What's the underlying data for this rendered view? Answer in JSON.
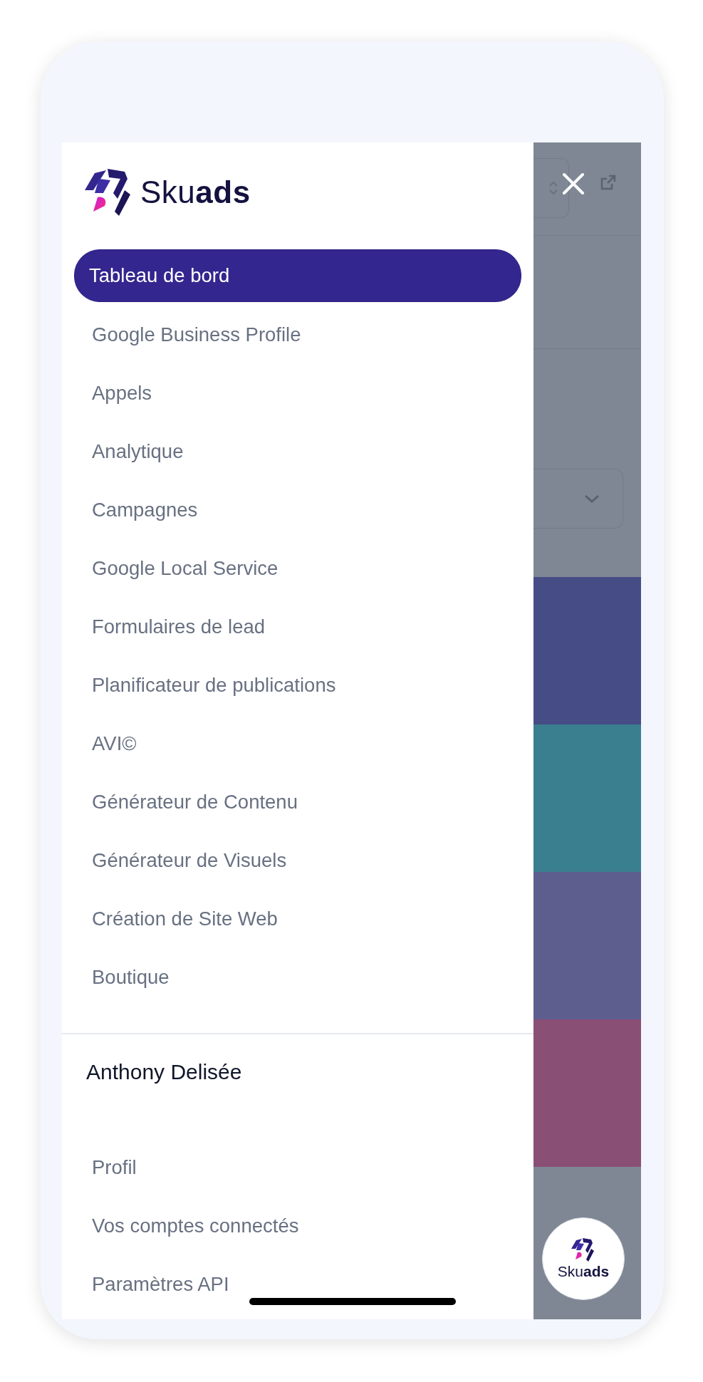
{
  "logo": {
    "text": "Sku**ads**"
  },
  "nav": {
    "items": [
      {
        "label": "Tableau de bord",
        "selected": true
      },
      {
        "label": "Google Business Profile",
        "selected": false
      },
      {
        "label": "Appels",
        "selected": false
      },
      {
        "label": "Analytique",
        "selected": false
      },
      {
        "label": "Campagnes",
        "selected": false
      },
      {
        "label": "Google Local Service",
        "selected": false
      },
      {
        "label": "Formulaires de lead",
        "selected": false
      },
      {
        "label": "Planificateur de publications",
        "selected": false
      },
      {
        "label": "AVI©",
        "selected": false
      },
      {
        "label": "Générateur de Contenu",
        "selected": false
      },
      {
        "label": "Générateur de Visuels",
        "selected": false
      },
      {
        "label": "Création de Site Web",
        "selected": false
      },
      {
        "label": "Boutique",
        "selected": false
      }
    ]
  },
  "user": {
    "name": "Anthony Delisée"
  },
  "account_menu": {
    "items": [
      {
        "label": "Profil"
      },
      {
        "label": "Vos comptes connectés"
      },
      {
        "label": "Paramètres API"
      }
    ]
  },
  "background_cards": [
    {
      "color": "#464c85"
    },
    {
      "color": "#3a7f8f"
    },
    {
      "color": "#5d5e8e"
    },
    {
      "color": "#8a4f75"
    }
  ],
  "chat_badge": {
    "text": "Sku**ads**"
  }
}
